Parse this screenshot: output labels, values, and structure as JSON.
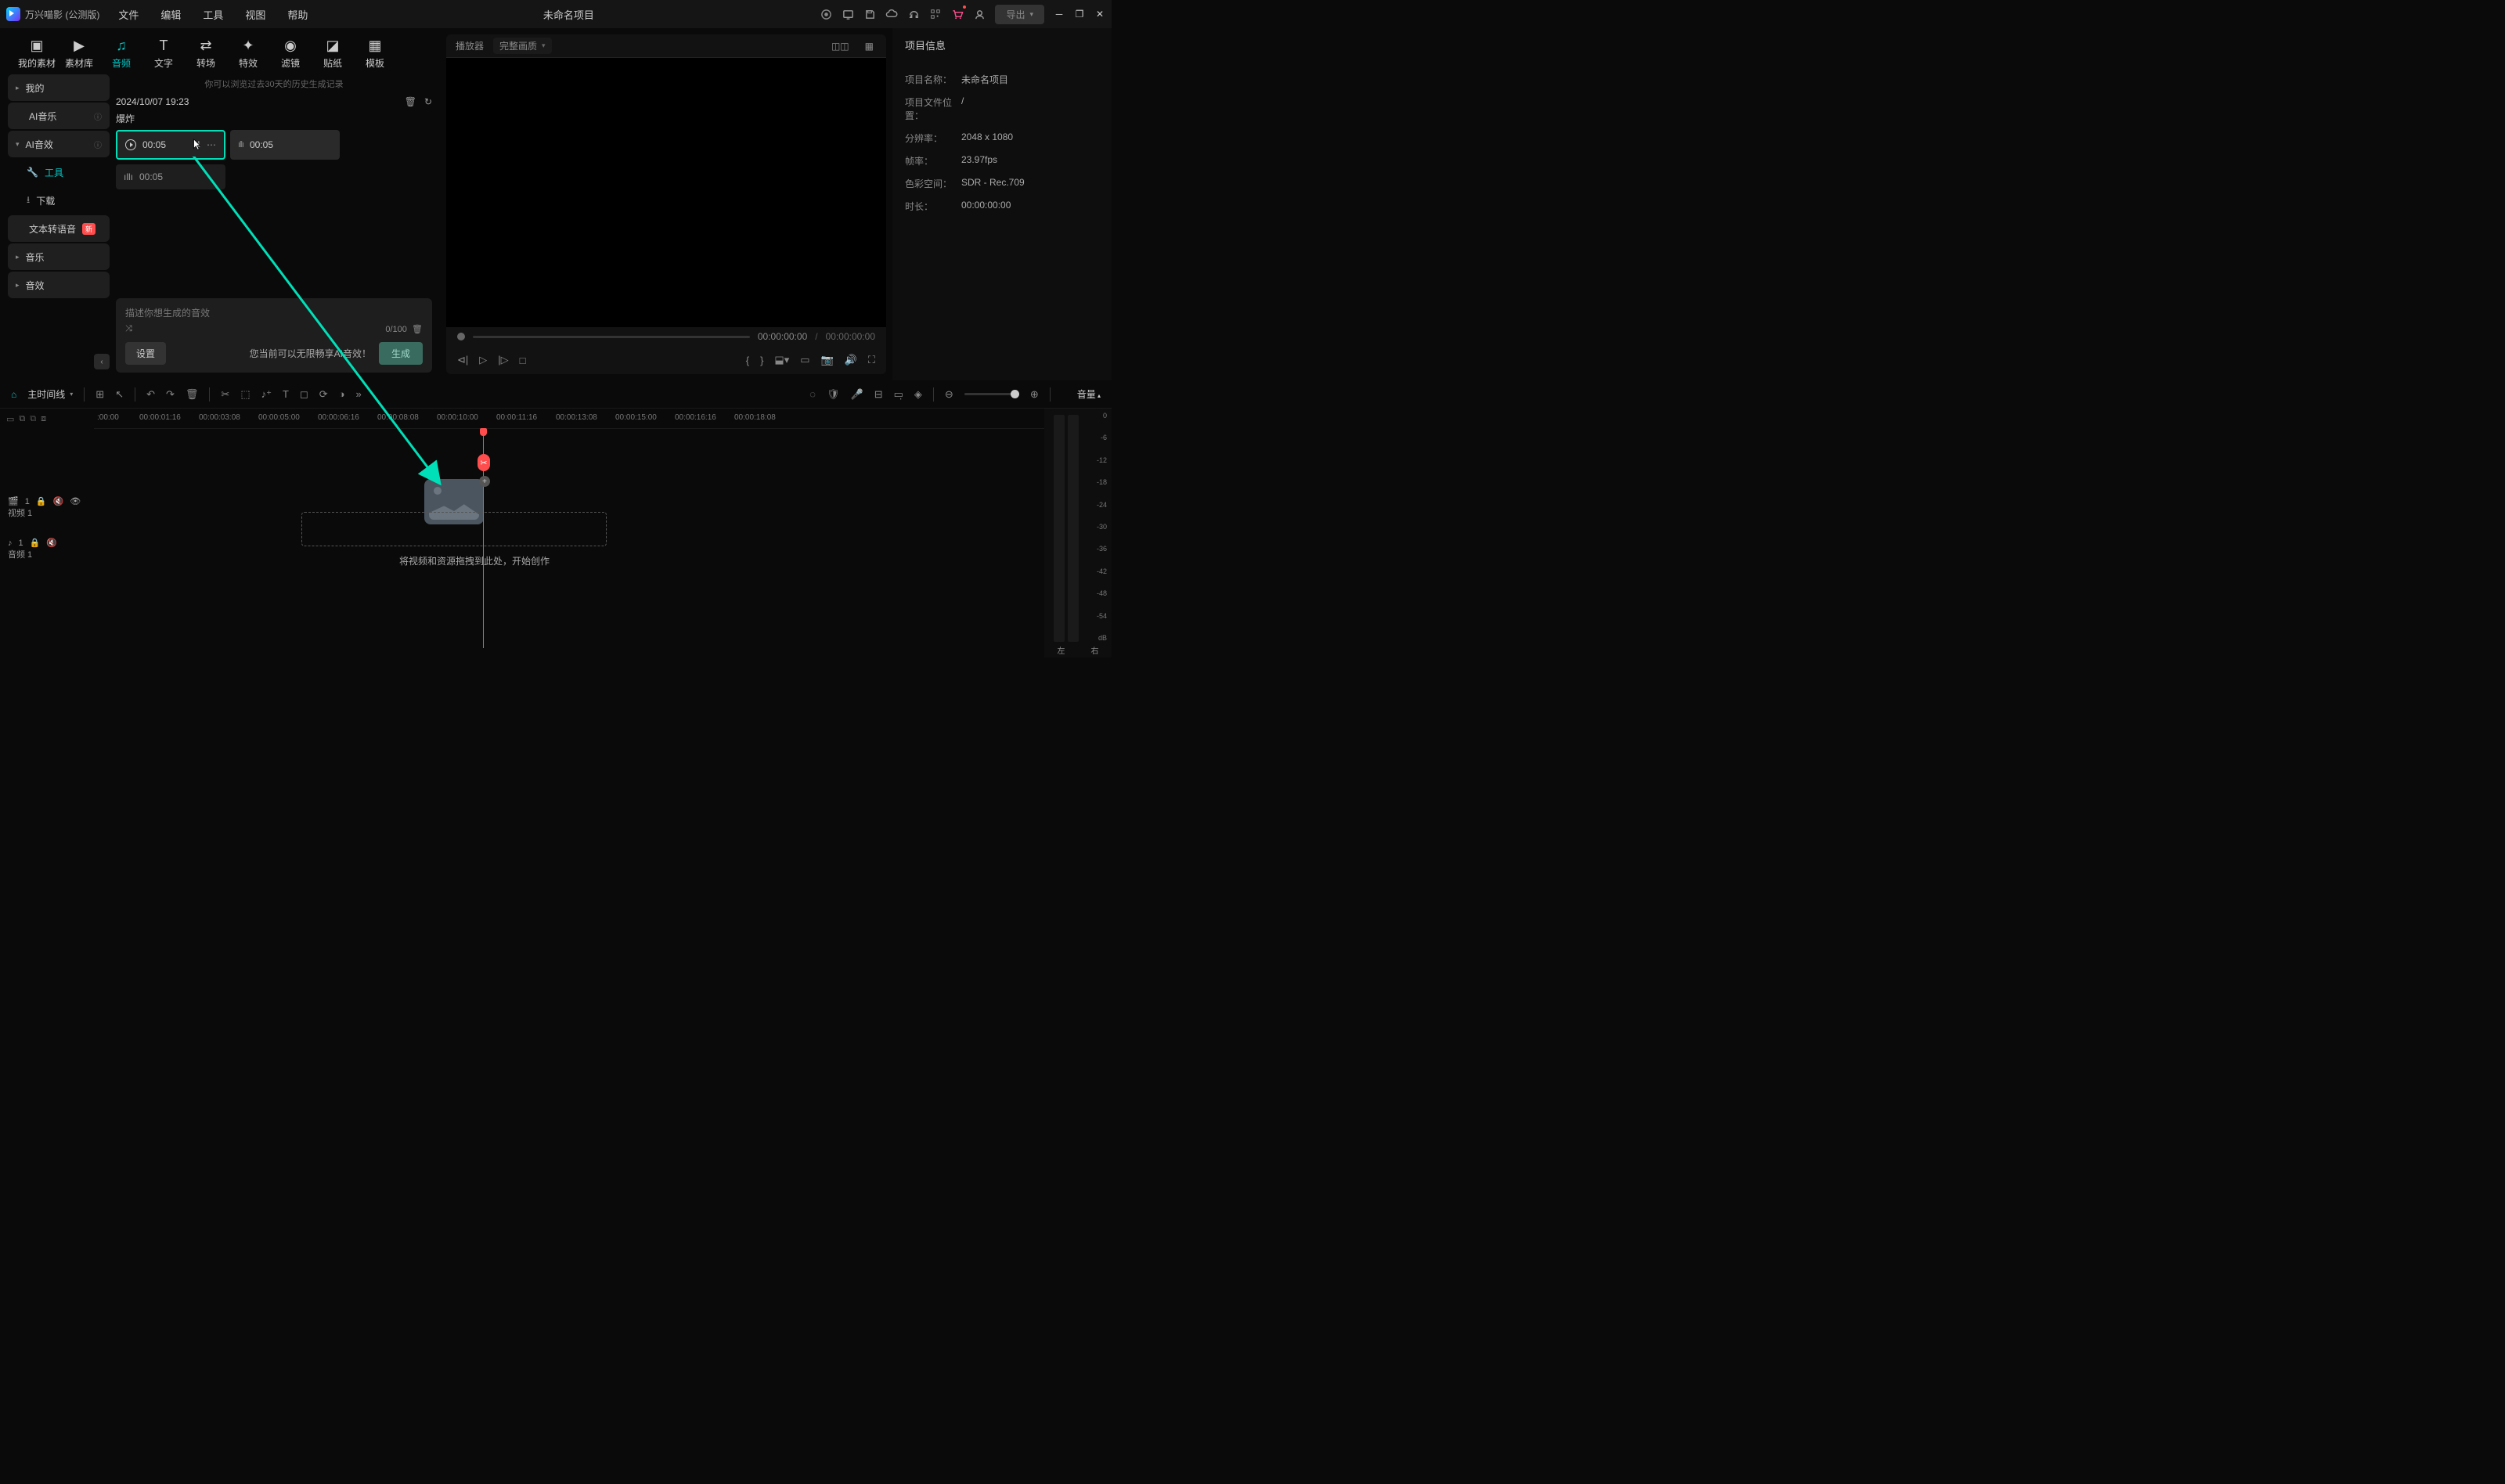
{
  "app": {
    "name": "万兴喵影 (公测版)",
    "project_title": "未命名项目"
  },
  "menu": {
    "file": "文件",
    "edit": "编辑",
    "tool": "工具",
    "view": "视图",
    "help": "帮助"
  },
  "export_btn": "导出",
  "tabs": {
    "my_media": "我的素材",
    "stock": "素材库",
    "audio": "音频",
    "text": "文字",
    "transition": "转场",
    "effect": "特效",
    "filter": "滤镜",
    "sticker": "贴纸",
    "template": "模板"
  },
  "sidebar": {
    "my": "我的",
    "ai_music": "AI音乐",
    "ai_sfx": "AI音效",
    "tool": "工具",
    "download": "下载",
    "tts": "文本转语音",
    "tts_badge": "新",
    "music": "音乐",
    "sfx": "音效"
  },
  "content": {
    "history_hint": "你可以浏览过去30天的历史生成记录",
    "history_date": "2024/10/07 19:23",
    "history_title": "爆炸",
    "clip1_dur": "00:05",
    "clip2_dur": "00:05",
    "clip3_dur": "00:05"
  },
  "gen": {
    "placeholder": "描述你想生成的音效",
    "counter": "0/100",
    "settings": "设置",
    "hint": "您当前可以无限畅享AI音效！",
    "generate": "生成"
  },
  "player": {
    "label": "播放器",
    "quality": "完整画质",
    "cur_time": "00:00:00:00",
    "total_time": "00:00:00:00"
  },
  "info": {
    "title": "项目信息",
    "name_label": "项目名称：",
    "name_value": "未命名项目",
    "path_label": "项目文件位置：",
    "path_value": "/",
    "res_label": "分辨率：",
    "res_value": "2048 x 1080",
    "fps_label": "帧率：",
    "fps_value": "23.97fps",
    "cs_label": "色彩空间：",
    "cs_value": "SDR - Rec.709",
    "dur_label": "时长：",
    "dur_value": "00:00:00:00"
  },
  "timeline": {
    "title": "主时间线",
    "vol_label": "音量",
    "ruler": [
      ":00:00",
      "00:00:01:16",
      "00:00:03:08",
      "00:00:05:00",
      "00:00:06:16",
      "00:00:08:08",
      "00:00:10:00",
      "00:00:11:16",
      "00:00:13:08",
      "00:00:15:00",
      "00:00:16:16",
      "00:00:18:08"
    ],
    "video_track": "视频 1",
    "audio_track": "音频 1",
    "v_badge": "1",
    "a_badge": "1",
    "drop_hint": "将视频和资源拖拽到此处，开始创作",
    "meter_labels": [
      "0",
      "-6",
      "-12",
      "-18",
      "-24",
      "-30",
      "-36",
      "-42",
      "-48",
      "-54",
      "dB"
    ],
    "meter_left": "左",
    "meter_right": "右"
  },
  "annotation": {
    "color": "#00e0b8"
  }
}
